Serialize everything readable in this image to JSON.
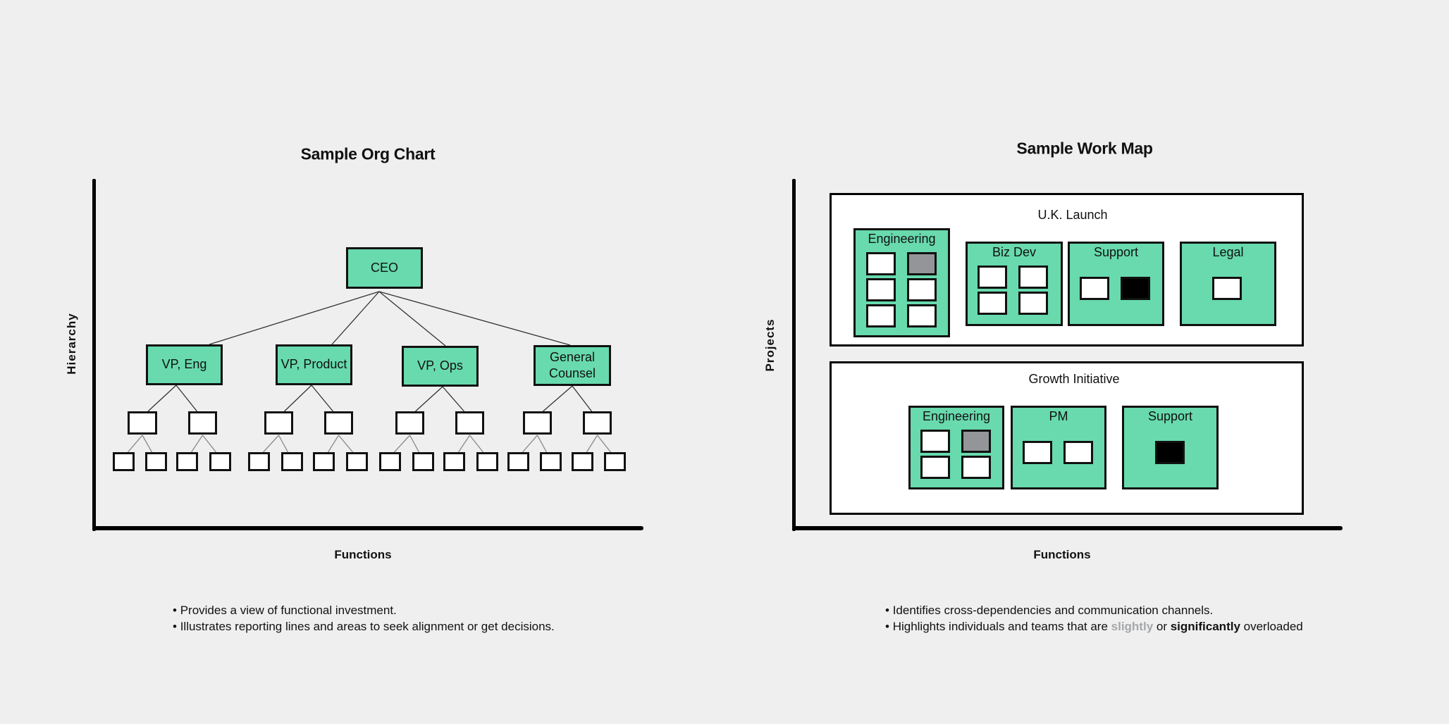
{
  "colors": {
    "background": "#efefef",
    "node_fill": "#68daae",
    "leaf_fill": "#ffffff",
    "slightly_overloaded": "#939598",
    "significantly_overloaded": "#000000",
    "slightly_text": "#a5a7aa"
  },
  "org_chart": {
    "title": "Sample Org Chart",
    "y_axis_label": "Hierarchy",
    "x_axis_label": "Functions",
    "root": "CEO",
    "vps": [
      {
        "label": "VP, Eng",
        "reports": 2,
        "sub_reports_each": 2
      },
      {
        "label": "VP, Product",
        "reports": 2,
        "sub_reports_each": 2
      },
      {
        "label": "VP, Ops",
        "reports": 2,
        "sub_reports_each": 2
      },
      {
        "label": "General Counsel",
        "label_line1": "General",
        "label_line2": "Counsel",
        "reports": 2,
        "sub_reports_each": 2
      }
    ],
    "bullets": [
      "Provides a view of functional investment.",
      "Illustrates reporting lines and areas to seek alignment or get decisions."
    ]
  },
  "work_map": {
    "title": "Sample Work Map",
    "y_axis_label": "Projects",
    "x_axis_label": "Functions",
    "projects": [
      {
        "name": "U.K. Launch",
        "teams": [
          {
            "name": "Engineering",
            "members": [
              "normal",
              "slight",
              "normal",
              "normal",
              "normal",
              "normal"
            ]
          },
          {
            "name": "Biz Dev",
            "members": [
              "normal",
              "normal",
              "normal",
              "normal"
            ]
          },
          {
            "name": "Support",
            "members": [
              "normal",
              "significant"
            ]
          },
          {
            "name": "Legal",
            "members": [
              "normal"
            ]
          }
        ]
      },
      {
        "name": "Growth Initiative",
        "teams": [
          {
            "name": "Engineering",
            "members": [
              "normal",
              "slight",
              "normal",
              "normal"
            ]
          },
          {
            "name": "PM",
            "members": [
              "normal",
              "normal"
            ]
          },
          {
            "name": "Support",
            "members": [
              "significant"
            ]
          }
        ]
      }
    ],
    "bullets": {
      "line1": "Identifies cross-dependencies and communication channels.",
      "line2_prefix": "Highlights individuals and teams that are ",
      "line2_slightly": "slightly",
      "line2_or": " or ",
      "line2_significantly": "significantly",
      "line2_suffix": " overloaded"
    }
  }
}
